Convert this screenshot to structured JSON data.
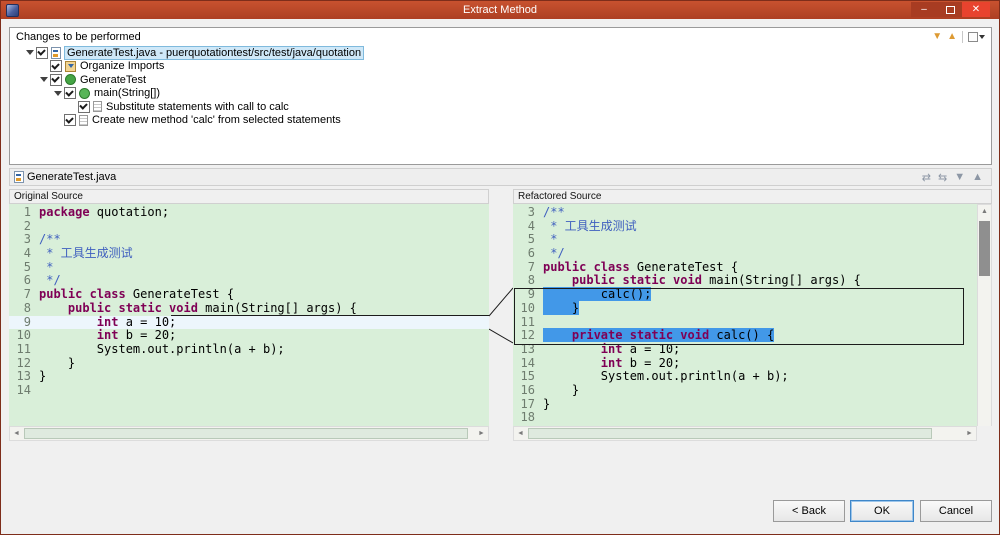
{
  "window": {
    "title": "Extract Method"
  },
  "icons": {
    "close": "✕",
    "minimize": "–",
    "next_change": "▼",
    "previous_change": "▲",
    "compare_toolbar": [
      "⇄",
      "⇆",
      "▼",
      "▲"
    ],
    "scroll_left": "◄",
    "scroll_right": "►",
    "scroll_up": "▲",
    "scroll_down": "▼"
  },
  "changes_panel": {
    "title": "Changes to be performed",
    "tree": [
      {
        "label": "GenerateTest.java - puerquotationtest/src/test/java/quotation",
        "level": 0,
        "expander": true,
        "checked": true,
        "icon": "java-file",
        "selected": true
      },
      {
        "label": "Organize Imports",
        "level": 1,
        "expander": false,
        "checked": true,
        "icon": "imports",
        "selected": false
      },
      {
        "label": "GenerateTest",
        "level": 1,
        "expander": true,
        "checked": true,
        "icon": "class",
        "selected": false
      },
      {
        "label": "main(String[])",
        "level": 2,
        "expander": true,
        "checked": true,
        "icon": "method",
        "selected": false
      },
      {
        "label": "Substitute statements with call to calc",
        "level": 3,
        "expander": false,
        "checked": true,
        "icon": "change",
        "selected": false
      },
      {
        "label": "Create new method 'calc' from selected statements",
        "level": 2,
        "expander": false,
        "checked": true,
        "icon": "change",
        "selected": false
      }
    ]
  },
  "preview": {
    "file_label": "GenerateTest.java",
    "left": {
      "title": "Original Source",
      "lines": [
        {
          "num": 1,
          "segs": [
            [
              "package",
              "kw"
            ],
            [
              " quotation;",
              "pl"
            ]
          ]
        },
        {
          "num": 2,
          "segs": []
        },
        {
          "num": 3,
          "segs": [
            [
              "/**",
              "doc"
            ]
          ]
        },
        {
          "num": 4,
          "segs": [
            [
              " * 工具生成测试",
              "doc"
            ]
          ]
        },
        {
          "num": 5,
          "segs": [
            [
              " *",
              "doc"
            ]
          ]
        },
        {
          "num": 6,
          "segs": [
            [
              " */",
              "doc"
            ]
          ]
        },
        {
          "num": 7,
          "segs": [
            [
              "public class",
              "kw"
            ],
            [
              " GenerateTest {",
              "pl"
            ]
          ]
        },
        {
          "num": 8,
          "segs": [
            [
              "    ",
              "pl"
            ],
            [
              "public static void",
              "kw"
            ],
            [
              " main(String[] args) {",
              "pl"
            ]
          ]
        },
        {
          "num": 9,
          "band": true,
          "segs": [
            [
              "        ",
              "pl"
            ],
            [
              "int",
              "kw"
            ],
            [
              " a = 10;",
              "pl"
            ]
          ]
        },
        {
          "num": 10,
          "segs": [
            [
              "        ",
              "pl"
            ],
            [
              "int",
              "kw"
            ],
            [
              " b = 20;",
              "pl"
            ]
          ]
        },
        {
          "num": 11,
          "segs": [
            [
              "        System.out.println(a + b);",
              "pl"
            ]
          ]
        },
        {
          "num": 12,
          "segs": [
            [
              "    }",
              "pl"
            ]
          ]
        },
        {
          "num": 13,
          "segs": [
            [
              "}",
              "pl"
            ]
          ]
        },
        {
          "num": 14,
          "segs": []
        }
      ]
    },
    "right": {
      "title": "Refactored Source",
      "lines": [
        {
          "num": 3,
          "segs": [
            [
              "/**",
              "doc"
            ]
          ]
        },
        {
          "num": 4,
          "segs": [
            [
              " * 工具生成测试",
              "doc"
            ]
          ]
        },
        {
          "num": 5,
          "segs": [
            [
              " *",
              "doc"
            ]
          ]
        },
        {
          "num": 6,
          "segs": [
            [
              " */",
              "doc"
            ]
          ]
        },
        {
          "num": 7,
          "segs": [
            [
              "public class",
              "kw"
            ],
            [
              " GenerateTest {",
              "pl"
            ]
          ]
        },
        {
          "num": 8,
          "segs": [
            [
              "    ",
              "pl"
            ],
            [
              "public static void",
              "kw"
            ],
            [
              " main(String[] args) {",
              "pl"
            ]
          ]
        },
        {
          "num": 9,
          "hl": true,
          "segs": [
            [
              "        calc();",
              "pl"
            ]
          ]
        },
        {
          "num": 10,
          "hl": true,
          "segs": [
            [
              "    }",
              "pl"
            ]
          ]
        },
        {
          "num": 11,
          "segs": []
        },
        {
          "num": 12,
          "hl": true,
          "segs": [
            [
              "    ",
              "pl"
            ],
            [
              "private static void",
              "kw"
            ],
            [
              " calc() {",
              "pl"
            ]
          ]
        },
        {
          "num": 13,
          "segs": [
            [
              "        ",
              "pl"
            ],
            [
              "int",
              "kw"
            ],
            [
              " a = 10;",
              "pl"
            ]
          ]
        },
        {
          "num": 14,
          "segs": [
            [
              "        ",
              "pl"
            ],
            [
              "int",
              "kw"
            ],
            [
              " b = 20;",
              "pl"
            ]
          ]
        },
        {
          "num": 15,
          "segs": [
            [
              "        System.out.println(a + b);",
              "pl"
            ]
          ]
        },
        {
          "num": 16,
          "segs": [
            [
              "    }",
              "pl"
            ]
          ]
        },
        {
          "num": 17,
          "segs": [
            [
              "}",
              "pl"
            ]
          ]
        },
        {
          "num": 18,
          "segs": []
        }
      ]
    }
  },
  "buttons": {
    "back": "< Back",
    "ok": "OK",
    "cancel": "Cancel"
  },
  "colors": {
    "titlebar_red": "#bf4326",
    "diff_green": "#d9efd9",
    "change_blue": "#4298e8",
    "keyword_purple": "#7f0055",
    "javadoc_blue": "#3f5fbf"
  }
}
